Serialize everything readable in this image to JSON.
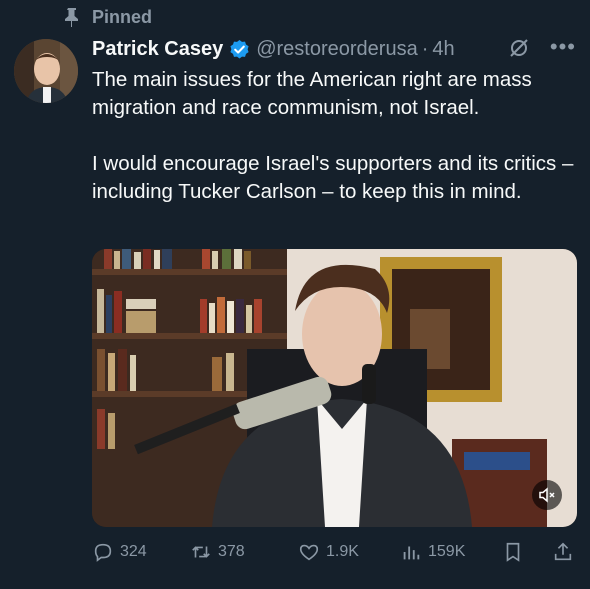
{
  "pinned_label": "Pinned",
  "author": {
    "name": "Patrick Casey",
    "handle": "@restoreorderusa",
    "time": "4h"
  },
  "tweet": {
    "text": "The main issues for the American right are mass migration and race communism, not Israel.\n\nI would encourage Israel's supporters and its critics – including Tucker Carlson – to keep this in mind."
  },
  "actions": {
    "replies": "324",
    "reposts": "378",
    "likes": "1.9K",
    "views": "159K"
  },
  "colors": {
    "background": "#15202b",
    "text": "#f7f9f9",
    "muted": "#8b98a5",
    "verified": "#1d9bf0"
  },
  "icons": [
    "pin-icon",
    "verified-badge-icon",
    "grok-icon",
    "more-icon",
    "mute-icon",
    "reply-icon",
    "repost-icon",
    "like-icon",
    "views-icon",
    "bookmark-icon",
    "share-icon"
  ]
}
